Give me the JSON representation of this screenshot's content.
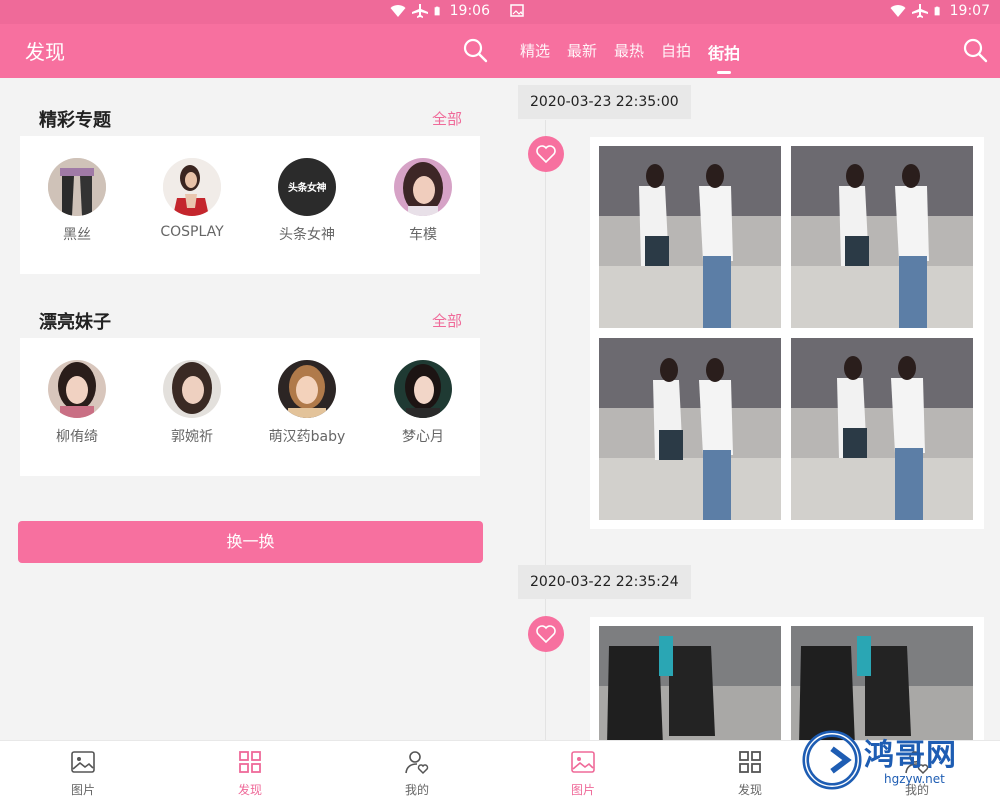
{
  "left": {
    "status": {
      "time": "19:06"
    },
    "appbar": {
      "title": "发现"
    },
    "topics": {
      "title": "精彩专题",
      "more": "全部",
      "items": [
        {
          "label": "黑丝"
        },
        {
          "label": "COSPLAY"
        },
        {
          "label": "头条女神",
          "logo_text": "头条女神"
        },
        {
          "label": "车模"
        }
      ]
    },
    "girls": {
      "title": "漂亮妹子",
      "more": "全部",
      "items": [
        {
          "label": "柳侑绮"
        },
        {
          "label": "郭婉祈"
        },
        {
          "label": "萌汉药baby"
        },
        {
          "label": "梦心月"
        }
      ]
    },
    "change_button": "换一换",
    "nav": [
      {
        "label": "图片",
        "icon": "image-icon"
      },
      {
        "label": "发现",
        "icon": "grid-icon"
      },
      {
        "label": "我的",
        "icon": "user-heart-icon"
      }
    ]
  },
  "right": {
    "status": {
      "time": "19:07"
    },
    "tabs": [
      "精选",
      "最新",
      "最热",
      "自拍",
      "街拍"
    ],
    "active_tab": "街拍",
    "posts": [
      {
        "date": "2020-03-23 22:35:00",
        "photos": 4
      },
      {
        "date": "2020-03-22 22:35:24",
        "photos": 2
      }
    ],
    "nav": [
      {
        "label": "图片",
        "icon": "image-icon"
      },
      {
        "label": "发现",
        "icon": "grid-icon"
      },
      {
        "label": "我的",
        "icon": "user-heart-icon"
      }
    ],
    "watermark": {
      "name": "鸿哥网",
      "url": "hgzyw.net"
    }
  },
  "colors": {
    "accent": "#f7709f",
    "statusbar": "#ef6a99",
    "watermark": "#1e5db3"
  }
}
